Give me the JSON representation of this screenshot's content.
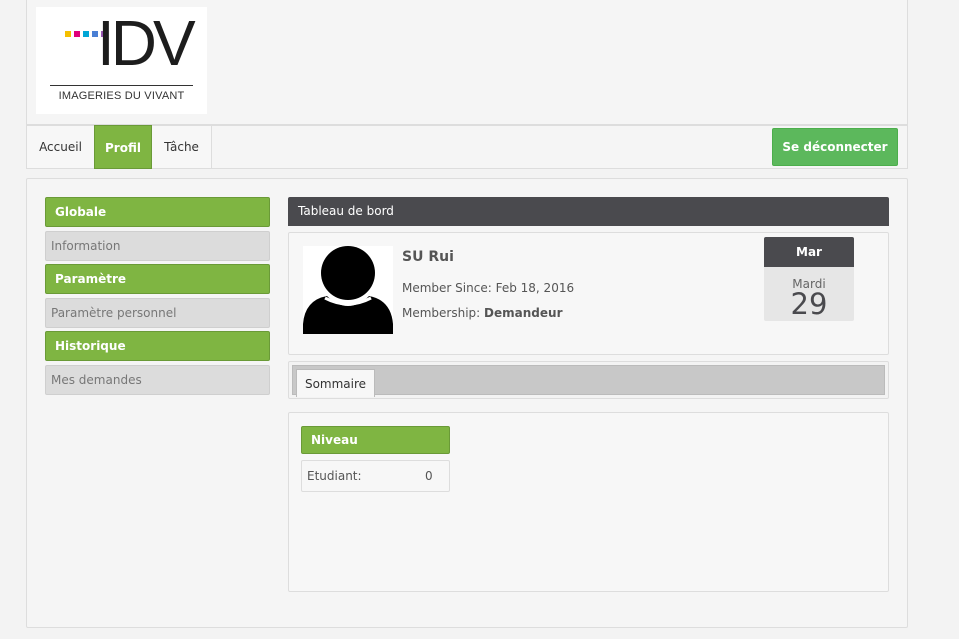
{
  "logo": {
    "letters": "IDV",
    "tagline": "IMAGERIES DU VIVANT",
    "dot_colors": [
      "#f5c000",
      "#e0007a",
      "#00a6d6",
      "#4a7fd4",
      "#9b59b6"
    ]
  },
  "nav": {
    "tabs": [
      {
        "label": "Accueil",
        "active": false
      },
      {
        "label": "Profil",
        "active": true
      },
      {
        "label": "Tâche",
        "active": false
      }
    ],
    "logout_label": "Se déconnecter"
  },
  "sidebar": {
    "sections": [
      {
        "heading": "Globale",
        "item": "Information"
      },
      {
        "heading": "Paramètre",
        "item": "Paramètre personnel"
      },
      {
        "heading": "Historique",
        "item": "Mes demandes"
      }
    ]
  },
  "dashboard": {
    "title": "Tableau de bord",
    "user": {
      "name": "SU Rui",
      "member_since_label": "Member Since:",
      "member_since_value": "Feb 18, 2016",
      "membership_label": "Membership:",
      "membership_value": "Demandeur"
    },
    "calendar": {
      "month": "Mar",
      "weekday": "Mardi",
      "day": "29"
    },
    "tabs": [
      {
        "label": "Sommaire",
        "active": true
      }
    ],
    "level": {
      "heading": "Niveau",
      "rows": [
        {
          "label": "Etudiant:",
          "value": "0"
        }
      ]
    }
  },
  "colors": {
    "accent_green": "#7fb542",
    "button_green": "#5cb85c",
    "dark_header": "#4a4a4e"
  }
}
